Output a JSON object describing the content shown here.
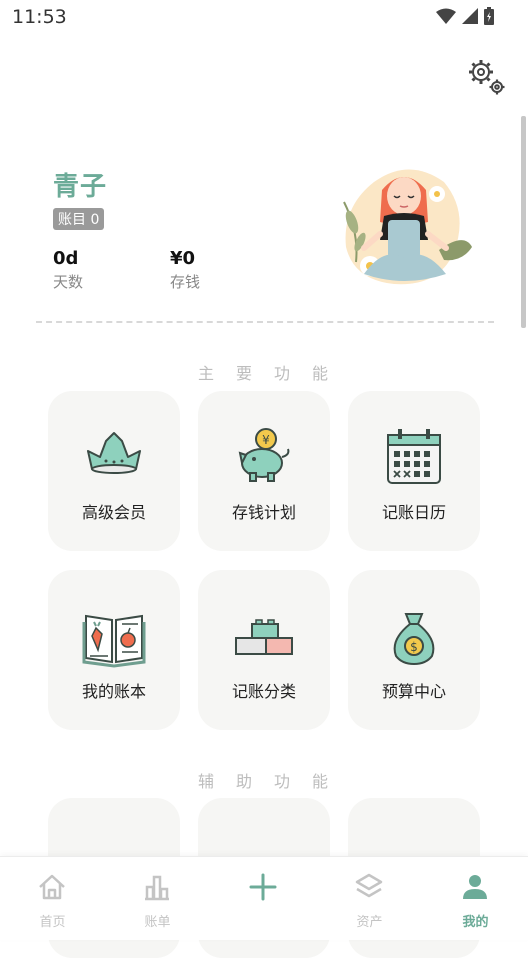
{
  "status_bar": {
    "time": "11:53"
  },
  "profile": {
    "name": "青子",
    "books_badge": "账目 0",
    "stats": [
      {
        "value": "0d",
        "label": "天数"
      },
      {
        "value": "¥0",
        "label": "存钱"
      }
    ]
  },
  "sections": {
    "main_title": "主要功能",
    "aux_title": "辅助功能"
  },
  "main_features": [
    {
      "label": "高级会员",
      "icon": "crown-icon"
    },
    {
      "label": "存钱计划",
      "icon": "piggy-bank-icon"
    },
    {
      "label": "记账日历",
      "icon": "calendar-icon"
    },
    {
      "label": "我的账本",
      "icon": "recipe-book-icon"
    },
    {
      "label": "记账分类",
      "icon": "blocks-icon"
    },
    {
      "label": "预算中心",
      "icon": "money-bag-icon"
    }
  ],
  "aux_features": [
    {
      "icon": "camera-icon"
    },
    {
      "icon": "receipt-icon"
    },
    {
      "icon": "bunting-icon"
    }
  ],
  "tabbar": {
    "items": [
      {
        "label": "首页",
        "icon": "home-icon"
      },
      {
        "label": "账单",
        "icon": "bar-chart-icon"
      },
      {
        "label": "",
        "icon": "add-icon"
      },
      {
        "label": "资产",
        "icon": "layers-icon"
      },
      {
        "label": "我的",
        "icon": "person-icon"
      }
    ],
    "active_index": 4
  },
  "colors": {
    "accent": "#6cab98",
    "card_bg": "#f6f6f4",
    "inactive": "#c4c4c4"
  }
}
